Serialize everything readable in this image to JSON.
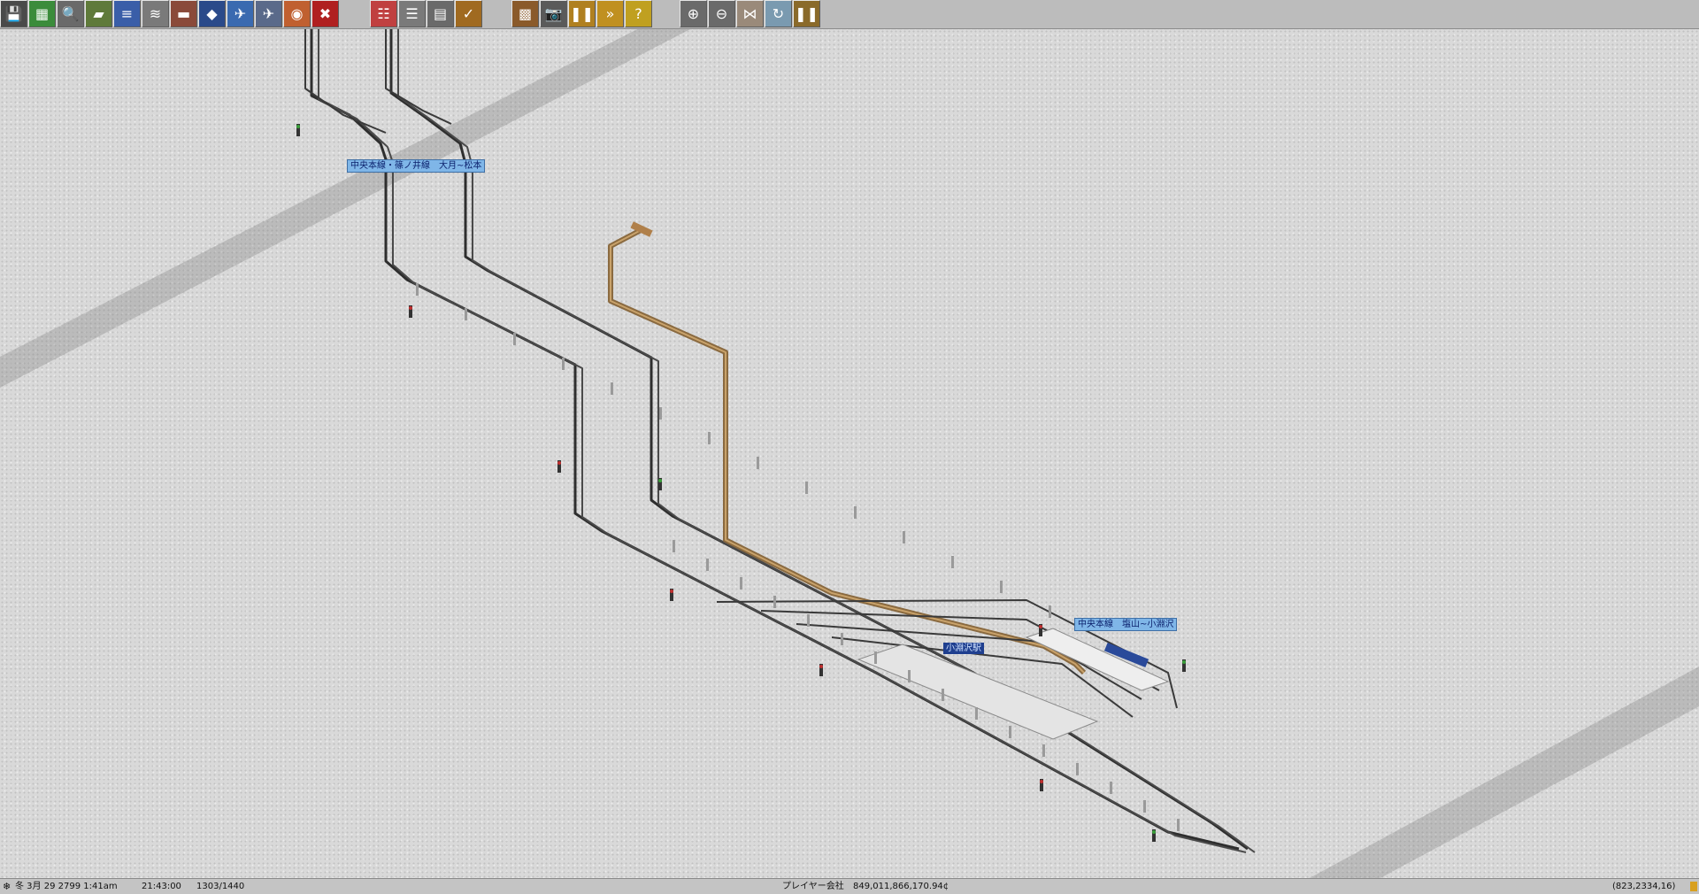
{
  "toolbar": {
    "buttons": [
      {
        "name": "save-icon",
        "glyph": "💾",
        "color": "#4a4a4a"
      },
      {
        "name": "minimap-icon",
        "glyph": "▦",
        "color": "#3b8c3b"
      },
      {
        "name": "inspect-icon",
        "glyph": "🔍",
        "color": "#6a6a6a"
      },
      {
        "name": "terrain-icon",
        "glyph": "▰",
        "color": "#5f7a3a"
      },
      {
        "name": "rail-tools-icon",
        "glyph": "≡",
        "color": "#3a5ea8"
      },
      {
        "name": "road-tools-icon",
        "glyph": "≋",
        "color": "#7a7a7a"
      },
      {
        "name": "tram-tools-icon",
        "glyph": "▬",
        "color": "#8a4a3a"
      },
      {
        "name": "ship-tools-icon",
        "glyph": "◆",
        "color": "#2a4a8a"
      },
      {
        "name": "air-tools-icon",
        "glyph": "✈",
        "color": "#3a6ab0"
      },
      {
        "name": "airport-icon",
        "glyph": "✈",
        "color": "#5a6a8a"
      },
      {
        "name": "special-tools-icon",
        "glyph": "◉",
        "color": "#c06030"
      },
      {
        "name": "demolish-icon",
        "glyph": "✖",
        "color": "#b02020"
      },
      {
        "name": "line-management-icon",
        "glyph": "☷",
        "color": "#c04040"
      },
      {
        "name": "list-icon",
        "glyph": "☰",
        "color": "#7a7a7a"
      },
      {
        "name": "finance-icon",
        "glyph": "▤",
        "color": "#6a6a6a"
      },
      {
        "name": "settings-icon",
        "glyph": "✓",
        "color": "#a06a20"
      },
      {
        "name": "rail-builder-icon",
        "glyph": "▩",
        "color": "#8a5a2a"
      },
      {
        "name": "screenshot-icon",
        "glyph": "📷",
        "color": "#5a5a5a"
      },
      {
        "name": "pause-icon",
        "glyph": "❚❚",
        "color": "#b08020"
      },
      {
        "name": "fast-forward-icon",
        "glyph": "»",
        "color": "#c09020"
      },
      {
        "name": "help-icon",
        "glyph": "?",
        "color": "#c0a020"
      },
      {
        "name": "zoom-in-icon",
        "glyph": "⊕",
        "color": "#6a6a6a"
      },
      {
        "name": "zoom-out-icon",
        "glyph": "⊖",
        "color": "#6a6a6a"
      },
      {
        "name": "grid-toggle-icon",
        "glyph": "⋈",
        "color": "#9a8a7a"
      },
      {
        "name": "compass-icon",
        "glyph": "↻",
        "color": "#7a9ab0"
      },
      {
        "name": "pause-alt-icon",
        "glyph": "❚❚",
        "color": "#8a6a2a"
      }
    ]
  },
  "map": {
    "line_labels": [
      {
        "text": "中央本線・篠ノ井線　大月~松本"
      },
      {
        "text": "中央本線　塩山~小淵沢"
      }
    ],
    "station_label": {
      "text": "小淵沢駅"
    }
  },
  "status": {
    "weather_icon": "snow-icon",
    "date": "冬 3月 29 2799 1:41am",
    "game_time": "21:43:00",
    "frame_info": "1303/1440",
    "company": "プレイヤー会社",
    "money": "849,011,866,170.94¢",
    "coords": "(823,2334,16)",
    "colors": {
      "money": "#1a1a8a",
      "company": "#1a1a8a"
    }
  }
}
